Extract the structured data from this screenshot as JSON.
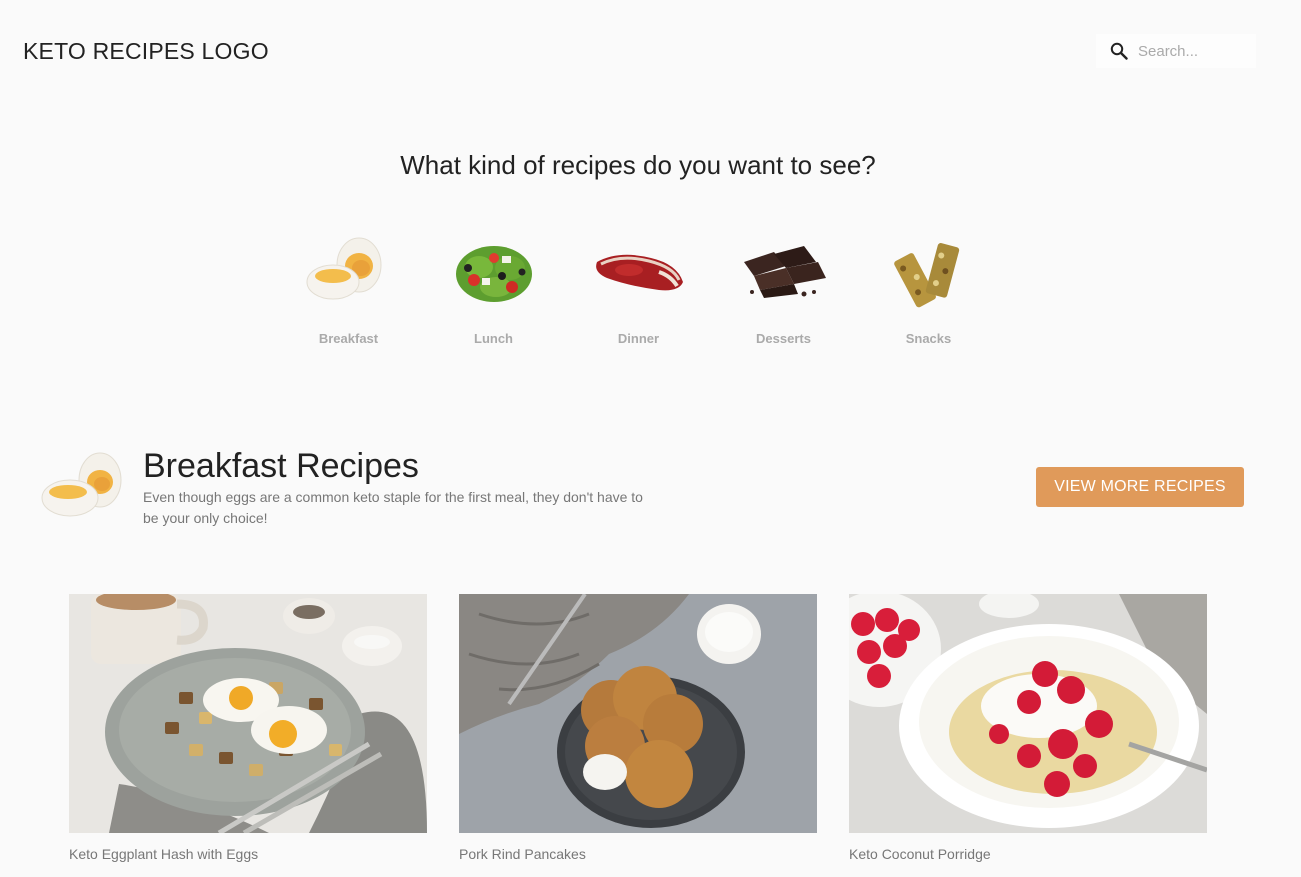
{
  "header": {
    "logo_text": "KETO RECIPES LOGO",
    "search_placeholder": "Search...",
    "search_icon": "search-icon"
  },
  "hero": {
    "question": "What kind of recipes do you want to see?"
  },
  "categories": [
    {
      "label": "Breakfast",
      "icon": "boiled-egg-image"
    },
    {
      "label": "Lunch",
      "icon": "salad-image"
    },
    {
      "label": "Dinner",
      "icon": "steak-image"
    },
    {
      "label": "Desserts",
      "icon": "chocolate-image"
    },
    {
      "label": "Snacks",
      "icon": "granola-bar-image"
    }
  ],
  "section": {
    "title": "Breakfast Recipes",
    "description": "Even though eggs are a common keto staple for the first meal, they don't have to be your only choice!",
    "button_label": "VIEW MORE RECIPES",
    "button_color": "#e09a5a"
  },
  "recipes": [
    {
      "title": "Keto Eggplant Hash with Eggs",
      "image": "eggplant-hash-photo"
    },
    {
      "title": "Pork Rind Pancakes",
      "image": "pancakes-photo"
    },
    {
      "title": "Keto Coconut Porridge",
      "image": "porridge-photo"
    }
  ]
}
